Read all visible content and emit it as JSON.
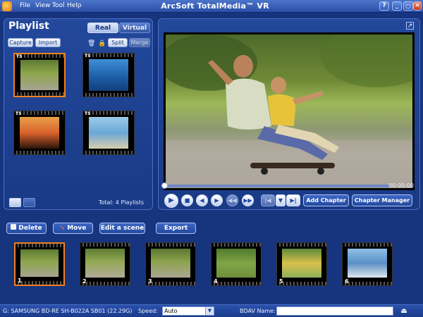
{
  "titlebar": {
    "title": "ArcSoft TotalMedia™ VR",
    "menus": [
      "File",
      "View",
      "Tool",
      "Help"
    ],
    "icons": [
      "help-icon",
      "minimize-icon",
      "maximize-icon",
      "close-icon"
    ]
  },
  "playlist": {
    "title": "Playlist",
    "tabs": [
      "Real",
      "Virtual"
    ],
    "buttons": {
      "capture": "Capture",
      "import": "Import",
      "split": "Split",
      "merge": "Merge"
    },
    "thumb_badge": "TS",
    "total": "Total: 4 Playlists"
  },
  "player": {
    "time": "00:00:00",
    "add_chapter": "Add Chapter",
    "chapter_manager": "Chapter Manager"
  },
  "actions": {
    "delete": "Delete",
    "move": "Move",
    "edit_scene": "Edit a scene",
    "export": "Export"
  },
  "scenes": [
    "1",
    "2",
    "3",
    "4",
    "5",
    "6"
  ],
  "status": {
    "drive": "G: SAMSUNG  BD-RE   SH-B022A SB01 (22.29G)",
    "speed_label": "Speed:",
    "speed_value": "Auto",
    "bdav_label": "BDAV Name:"
  },
  "colors": {
    "accent": "#f08020",
    "panel": "#1d3f8d",
    "background": "#17347f"
  }
}
